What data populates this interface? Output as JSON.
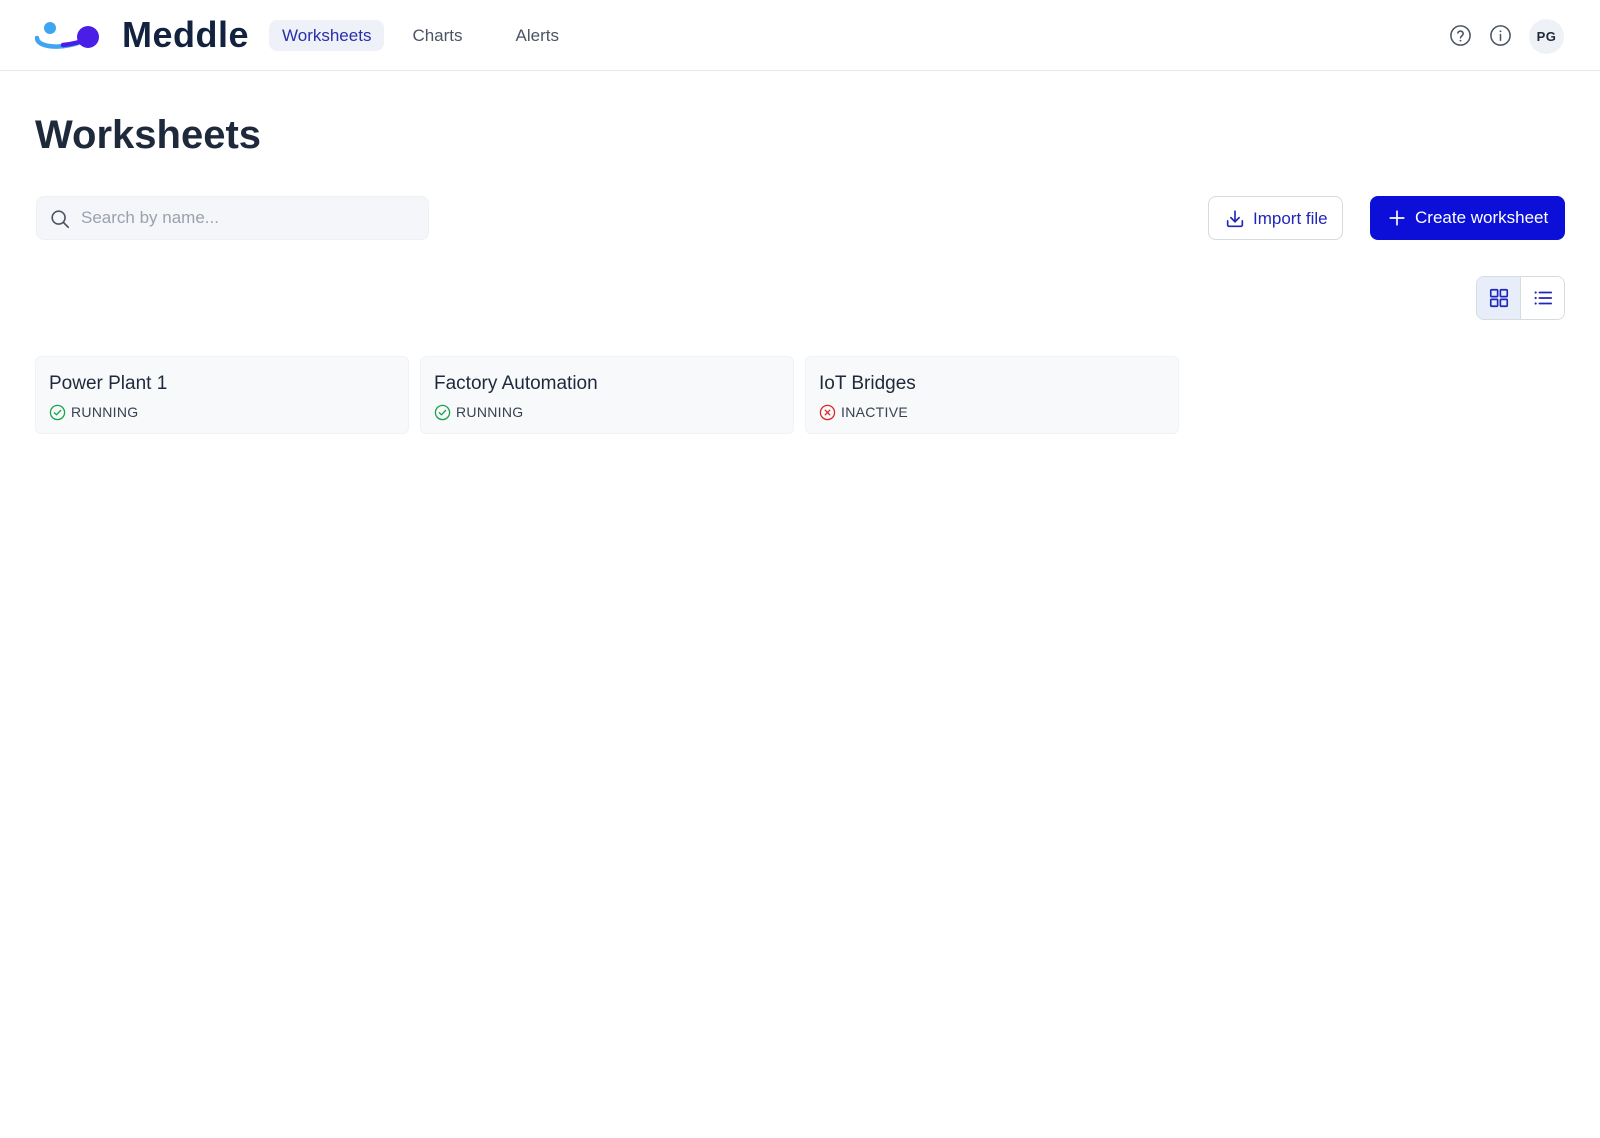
{
  "app": {
    "name": "Meddle",
    "accent": "#0b0fd8",
    "logo_colors": [
      "#3fa5f0",
      "#4b1ee8"
    ]
  },
  "nav": {
    "items": [
      {
        "label": "Worksheets",
        "active": true
      },
      {
        "label": "Charts",
        "active": false
      },
      {
        "label": "Alerts",
        "active": false
      }
    ]
  },
  "header": {
    "help_icon": "question-circle-icon",
    "info_icon": "info-circle-icon",
    "avatar_initials": "PG"
  },
  "page": {
    "title": "Worksheets"
  },
  "search": {
    "placeholder": "Search by name...",
    "value": ""
  },
  "actions": {
    "import_label": "Import file",
    "import_icon": "download-icon",
    "create_label": "Create worksheet",
    "create_icon": "plus-icon"
  },
  "view_toggle": {
    "selected": "grid",
    "options": [
      "grid",
      "list"
    ]
  },
  "worksheets": [
    {
      "name": "Power Plant 1",
      "status": "RUNNING",
      "status_color": "#16a34a",
      "status_icon": "check-circle-icon"
    },
    {
      "name": "Factory Automation",
      "status": "RUNNING",
      "status_color": "#16a34a",
      "status_icon": "check-circle-icon"
    },
    {
      "name": "IoT Bridges",
      "status": "INACTIVE",
      "status_color": "#dc2626",
      "status_icon": "x-circle-icon"
    }
  ]
}
